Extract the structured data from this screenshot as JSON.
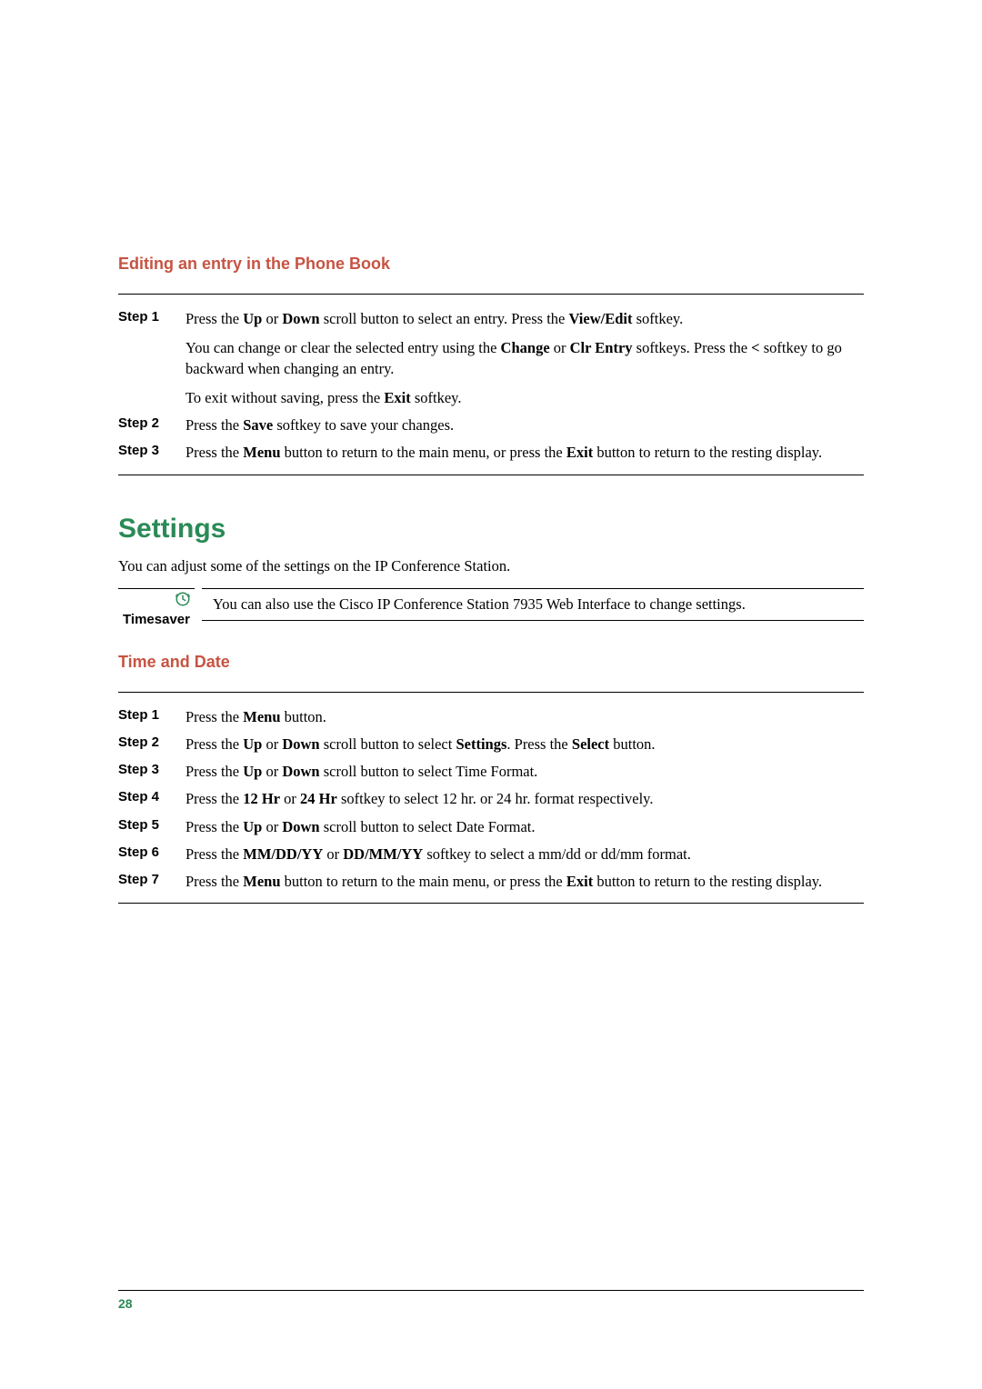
{
  "section1": {
    "title": "Editing an entry in the Phone Book",
    "steps": [
      {
        "label": "Step 1",
        "paras": [
          {
            "segments": [
              {
                "t": "Press the "
              },
              {
                "t": "Up",
                "b": true
              },
              {
                "t": " or "
              },
              {
                "t": "Down",
                "b": true
              },
              {
                "t": " scroll button to select an entry. Press the "
              },
              {
                "t": "View/Edit",
                "b": true
              },
              {
                "t": " softkey."
              }
            ]
          },
          {
            "segments": [
              {
                "t": "You can change or clear the selected entry using the "
              },
              {
                "t": "Change",
                "b": true
              },
              {
                "t": " or "
              },
              {
                "t": "Clr Entry",
                "b": true
              },
              {
                "t": " softkeys. Press the "
              },
              {
                "t": "<",
                "b": true
              },
              {
                "t": " softkey to go backward when changing an entry."
              }
            ]
          },
          {
            "segments": [
              {
                "t": "To exit without saving, press the "
              },
              {
                "t": "Exit",
                "b": true
              },
              {
                "t": " softkey."
              }
            ]
          }
        ]
      },
      {
        "label": "Step 2",
        "paras": [
          {
            "segments": [
              {
                "t": "Press the "
              },
              {
                "t": "Save",
                "b": true
              },
              {
                "t": " softkey to save your changes."
              }
            ]
          }
        ]
      },
      {
        "label": "Step 3",
        "paras": [
          {
            "segments": [
              {
                "t": "Press the "
              },
              {
                "t": "Menu",
                "b": true
              },
              {
                "t": " button to return to the main menu, or press the "
              },
              {
                "t": "Exit",
                "b": true
              },
              {
                "t": " button to return to the resting display."
              }
            ]
          }
        ]
      }
    ]
  },
  "section2": {
    "title": "Settings",
    "intro": "You can adjust some of the settings on the IP Conference Station.",
    "tip": {
      "label": "Timesaver",
      "text": "You can also use the Cisco IP Conference Station 7935 Web Interface to change settings."
    }
  },
  "section3": {
    "title": "Time and Date",
    "steps": [
      {
        "label": "Step 1",
        "paras": [
          {
            "segments": [
              {
                "t": "Press the "
              },
              {
                "t": "Menu",
                "b": true
              },
              {
                "t": " button."
              }
            ]
          }
        ]
      },
      {
        "label": "Step 2",
        "paras": [
          {
            "segments": [
              {
                "t": "Press the "
              },
              {
                "t": "Up",
                "b": true
              },
              {
                "t": " or "
              },
              {
                "t": "Down",
                "b": true
              },
              {
                "t": " scroll button to select "
              },
              {
                "t": "Settings",
                "b": true
              },
              {
                "t": ". Press the "
              },
              {
                "t": "Select",
                "b": true
              },
              {
                "t": " button."
              }
            ]
          }
        ]
      },
      {
        "label": "Step 3",
        "paras": [
          {
            "segments": [
              {
                "t": "Press the "
              },
              {
                "t": "Up",
                "b": true
              },
              {
                "t": " or "
              },
              {
                "t": "Down",
                "b": true
              },
              {
                "t": " scroll button to select Time Format."
              }
            ]
          }
        ]
      },
      {
        "label": "Step 4",
        "paras": [
          {
            "segments": [
              {
                "t": "Press the "
              },
              {
                "t": "12 Hr",
                "b": true
              },
              {
                "t": " or "
              },
              {
                "t": "24 Hr",
                "b": true
              },
              {
                "t": " softkey to select 12 hr. or 24 hr. format respectively."
              }
            ]
          }
        ]
      },
      {
        "label": "Step 5",
        "paras": [
          {
            "segments": [
              {
                "t": "Press the "
              },
              {
                "t": "Up",
                "b": true
              },
              {
                "t": " or "
              },
              {
                "t": "Down",
                "b": true
              },
              {
                "t": " scroll button to select Date Format."
              }
            ]
          }
        ]
      },
      {
        "label": "Step 6",
        "paras": [
          {
            "segments": [
              {
                "t": "Press the "
              },
              {
                "t": "MM/DD/YY",
                "b": true
              },
              {
                "t": " or "
              },
              {
                "t": "DD/MM/YY",
                "b": true
              },
              {
                "t": " softkey to select a mm/dd or dd/mm format."
              }
            ]
          }
        ]
      },
      {
        "label": "Step 7",
        "paras": [
          {
            "segments": [
              {
                "t": "Press the "
              },
              {
                "t": "Menu",
                "b": true
              },
              {
                "t": " button to return to the main menu, or press the "
              },
              {
                "t": "Exit",
                "b": true
              },
              {
                "t": " button to return to the resting display."
              }
            ]
          }
        ]
      }
    ]
  },
  "page_number": "28"
}
